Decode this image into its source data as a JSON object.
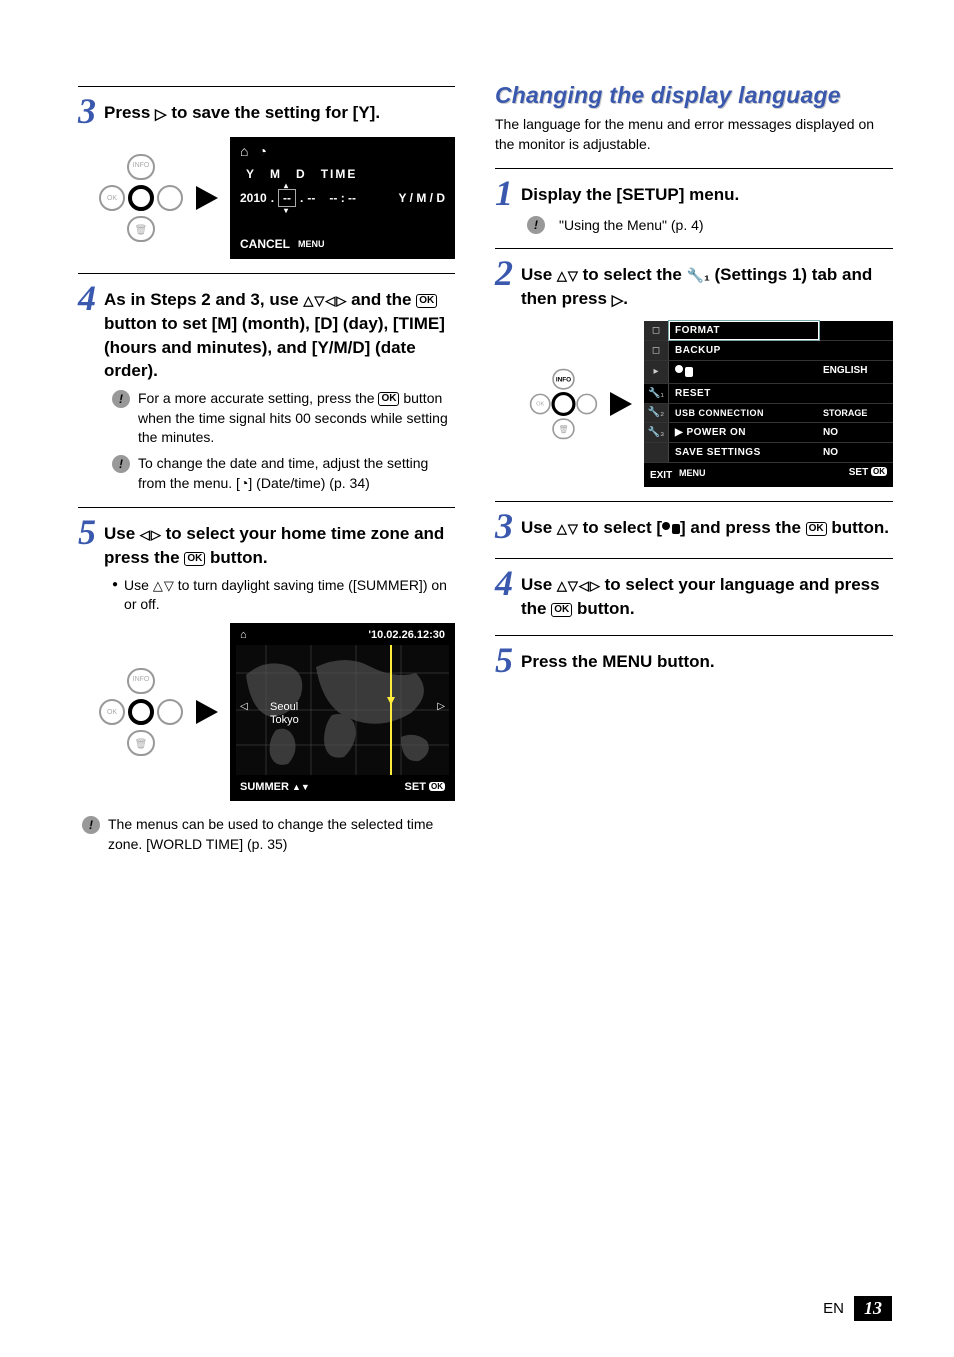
{
  "left": {
    "s3": {
      "text_a": "Press ",
      "text_b": " to save the setting for [Y]."
    },
    "lcd1": {
      "hdr_y": "Y",
      "hdr_m": "M",
      "hdr_d": "D",
      "hdr_time": "TIME",
      "year": "2010",
      "dot": ".",
      "sel": "--",
      "d1": "--",
      "t1": "-- : --",
      "order": "Y / M / D",
      "cancel": "CANCEL",
      "menu": "MENU"
    },
    "s4": {
      "text_a": "As in Steps 2 and 3, use ",
      "text_b": " and the ",
      "text_c": " button to set [M] (month), [D] (day), [TIME] (hours and minutes), and [Y/M/D] (date order).",
      "note1_a": "For a more accurate setting, press the ",
      "note1_b": " button when the time signal hits 00 seconds while setting the minutes.",
      "note2_a": "To change the date and time, adjust the setting from the menu. [",
      "note2_b": "] (Date/time) (p. 34)"
    },
    "s5": {
      "text_a": "Use ",
      "text_b": " to select your home time zone and press the ",
      "text_c": " button.",
      "bullet_a": "Use ",
      "bullet_b": " to turn daylight saving time ([SUMMER]) on or off."
    },
    "lcd2": {
      "datetime": "'10.02.26.12:30",
      "city1": "Seoul",
      "city2": "Tokyo",
      "summer": "SUMMER",
      "set": "SET"
    },
    "note3": "The menus can be used to change the selected time zone. [WORLD TIME] (p. 35)"
  },
  "right": {
    "heading": "Changing the display language",
    "intro": "The language for the menu and error messages displayed on the monitor is adjustable.",
    "s1": {
      "text": "Display the [SETUP] menu.",
      "sub": "\"Using the Menu\" (p. 4)"
    },
    "s2": {
      "text_a": "Use ",
      "text_b": " to select the ",
      "text_c": " (Settings 1) tab and then press ",
      "text_d": ".",
      "wrench": "🔧₁"
    },
    "setup": {
      "rows": [
        {
          "label": "FORMAT",
          "val": ""
        },
        {
          "label": "BACKUP",
          "val": ""
        },
        {
          "label": "",
          "val": "ENGLISH",
          "lang": true
        },
        {
          "label": "RESET",
          "val": ""
        },
        {
          "label": "USB CONNECTION",
          "val": "STORAGE"
        },
        {
          "label": "▶ POWER ON",
          "val": "NO",
          "boxed": true
        },
        {
          "label": "SAVE SETTINGS",
          "val": "NO"
        }
      ],
      "exit": "EXIT",
      "menu": "MENU",
      "set": "SET"
    },
    "s3": {
      "text_a": "Use ",
      "text_b": " to select [",
      "text_c": "] and press the ",
      "text_d": " button."
    },
    "s4": {
      "text_a": "Use ",
      "text_b": " to select your language and press the ",
      "text_c": " button."
    },
    "s5": {
      "text_a": "Press the ",
      "text_b": " button.",
      "menu": "MENU"
    }
  },
  "footer": {
    "en": "EN",
    "page": "13"
  }
}
